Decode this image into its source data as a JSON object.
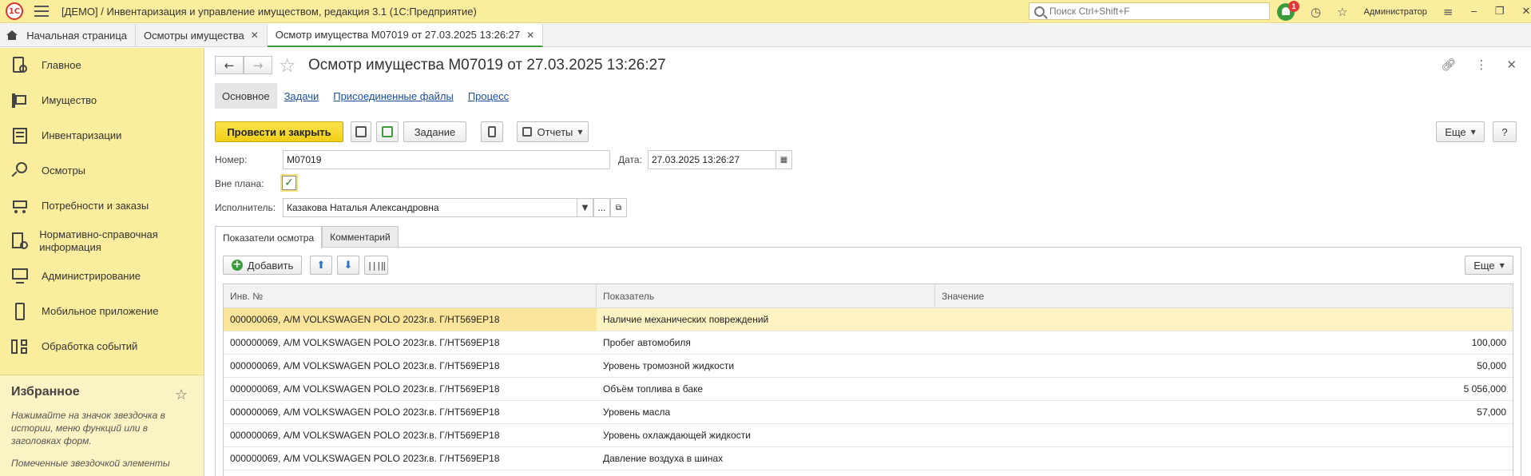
{
  "titlebar": {
    "logo": "1С",
    "title": "[ДЕМО] / Инвентаризация и управление имуществом, редакция 3.1  (1С:Предприятие)",
    "search_placeholder": "Поиск Ctrl+Shift+F",
    "notifications_count": "1",
    "user": "Администратор"
  },
  "tabs": {
    "home": "Начальная страница",
    "list": "Осмотры имущества",
    "doc": "Осмотр имущества М07019 от 27.03.2025 13:26:27"
  },
  "sidebar": {
    "items": [
      {
        "label": "Главное",
        "icon": "home-doc-icon"
      },
      {
        "label": "Имущество",
        "icon": "property-icon"
      },
      {
        "label": "Инвентаризации",
        "icon": "checklist-icon"
      },
      {
        "label": "Осмотры",
        "icon": "inspection-icon"
      },
      {
        "label": "Потребности и заказы",
        "icon": "cart-icon"
      },
      {
        "label": "Нормативно-справочная информация",
        "icon": "reference-icon"
      },
      {
        "label": "Администрирование",
        "icon": "admin-icon"
      },
      {
        "label": "Мобильное приложение",
        "icon": "mobile-icon"
      },
      {
        "label": "Обработка событий",
        "icon": "events-icon"
      }
    ],
    "favorites": {
      "title": "Избранное",
      "hint1": "Нажимайте на значок звездочка в истории, меню функций или в заголовках форм.",
      "hint2": "Помеченные звездочкой элементы"
    }
  },
  "form": {
    "title": "Осмотр имущества М07019 от 27.03.2025 13:26:27",
    "subtabs": [
      "Основное",
      "Задачи",
      "Присоединенные файлы",
      "Процесс"
    ],
    "toolbar": {
      "post_close": "Провести и закрыть",
      "task": "Задание",
      "reports": "Отчеты",
      "more": "Еще",
      "help": "?"
    },
    "fields": {
      "number_label": "Номер:",
      "number_value": "М07019",
      "date_label": "Дата:",
      "date_value": "27.03.2025 13:26:27",
      "unplanned_label": "Вне плана:",
      "executor_label": "Исполнитель:",
      "executor_value": "Казакова Наталья Александровна"
    },
    "panel_tabs": [
      "Показатели осмотра",
      "Комментарий"
    ],
    "panel_toolbar": {
      "add": "Добавить",
      "more": "Еще"
    },
    "grid": {
      "columns": [
        "Инв. №",
        "Показатель",
        "Значение"
      ],
      "rows": [
        {
          "inv": "000000069, А/М VOLKSWAGEN POLO 2023г.в. Г/НТ569ЕР18",
          "indicator": "Наличие механических повреждений",
          "value": ""
        },
        {
          "inv": "000000069, А/М VOLKSWAGEN POLO 2023г.в. Г/НТ569ЕР18",
          "indicator": "Пробег автомобиля",
          "value": "100,000"
        },
        {
          "inv": "000000069, А/М VOLKSWAGEN POLO 2023г.в. Г/НТ569ЕР18",
          "indicator": "Уровень тромозной жидкости",
          "value": "50,000"
        },
        {
          "inv": "000000069, А/М VOLKSWAGEN POLO 2023г.в. Г/НТ569ЕР18",
          "indicator": "Объём топлива в баке",
          "value": "5 056,000"
        },
        {
          "inv": "000000069, А/М VOLKSWAGEN POLO 2023г.в. Г/НТ569ЕР18",
          "indicator": "Уровень масла",
          "value": "57,000"
        },
        {
          "inv": "000000069, А/М VOLKSWAGEN POLO 2023г.в. Г/НТ569ЕР18",
          "indicator": "Уровень охлаждающей жидкости",
          "value": ""
        },
        {
          "inv": "000000069, А/М VOLKSWAGEN POLO 2023г.в. Г/НТ569ЕР18",
          "indicator": "Давление воздуха в шинах",
          "value": ""
        }
      ]
    }
  },
  "colors": {
    "accent_yellow": "#fbed9e",
    "primary_button": "#f1cf17",
    "active_tab_line": "#3a9d3c",
    "link": "#1a4fa3"
  }
}
